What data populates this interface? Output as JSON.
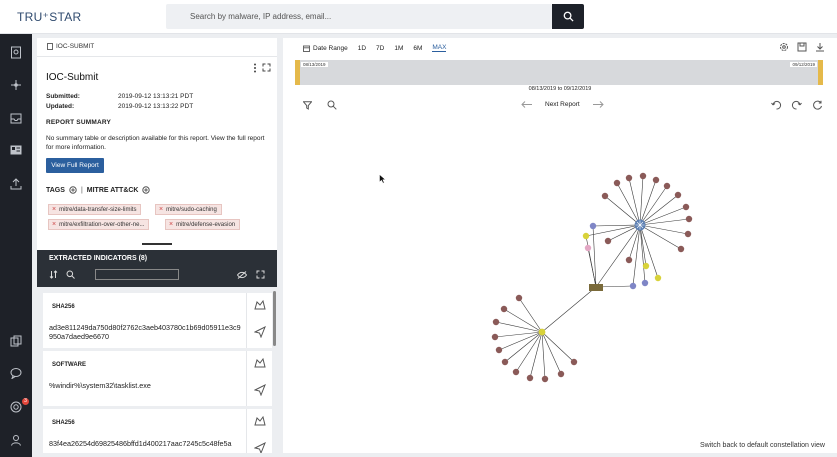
{
  "brand": {
    "logo": "TRU⁺STAR"
  },
  "search": {
    "placeholder": "Search by malware, IP address, email..."
  },
  "report": {
    "breadcrumb": "IOC-SUBMIT",
    "title": "IOC-Submit",
    "submitted_label": "Submitted:",
    "submitted": "2019-09-12 13:13:21 PDT",
    "updated_label": "Updated:",
    "updated": "2019-09-12 13:13:22 PDT",
    "summary_heading": "REPORT SUMMARY",
    "summary_text": "No summary table or description available for this report. View the full report for more information.",
    "view_full_label": "View Full Report",
    "tags_label": "TAGS",
    "mitre_label": "MITRE ATT&CK",
    "tags": [
      "mitre/data-transfer-size-limits",
      "mitre/sudo-caching",
      "mitre/exfiltration-over-other-ne...",
      "mitre/defense-evasion"
    ]
  },
  "indicators": {
    "title": "EXTRACTED INDICATORS (8)",
    "items": [
      {
        "type": "SHA256",
        "value": "ad3e811249da750d80f2762c3aeb403780c1b69d05911e3c9950a7daed9e6670"
      },
      {
        "type": "SOFTWARE",
        "value": "%windir%\\system32\\tasklist.exe"
      },
      {
        "type": "SHA256",
        "value": "83f4ea26254d69825486bffd1d400217aac7245c5c48fe5a"
      }
    ]
  },
  "graph": {
    "date_range_label": "Date Range",
    "ranges": [
      "1D",
      "7D",
      "1M",
      "6M",
      "MAX"
    ],
    "selected_range": "MAX",
    "timeline_start": "08/13/2019",
    "timeline_end": "09/12/2019",
    "timeline_caption": "08/13/2019 to 09/12/2019",
    "next_report_label": "Next Report",
    "switch_label": "Switch back to default constellation view"
  },
  "rail": {
    "chat_badge": "3"
  },
  "colors": {
    "accent": "#2b5f9e",
    "rail": "#1e2128",
    "tag_bg": "#f6e4e2",
    "node_brown": "#8a5a58",
    "node_yellow": "#d8d23a",
    "node_blue": "#7f86c6"
  }
}
